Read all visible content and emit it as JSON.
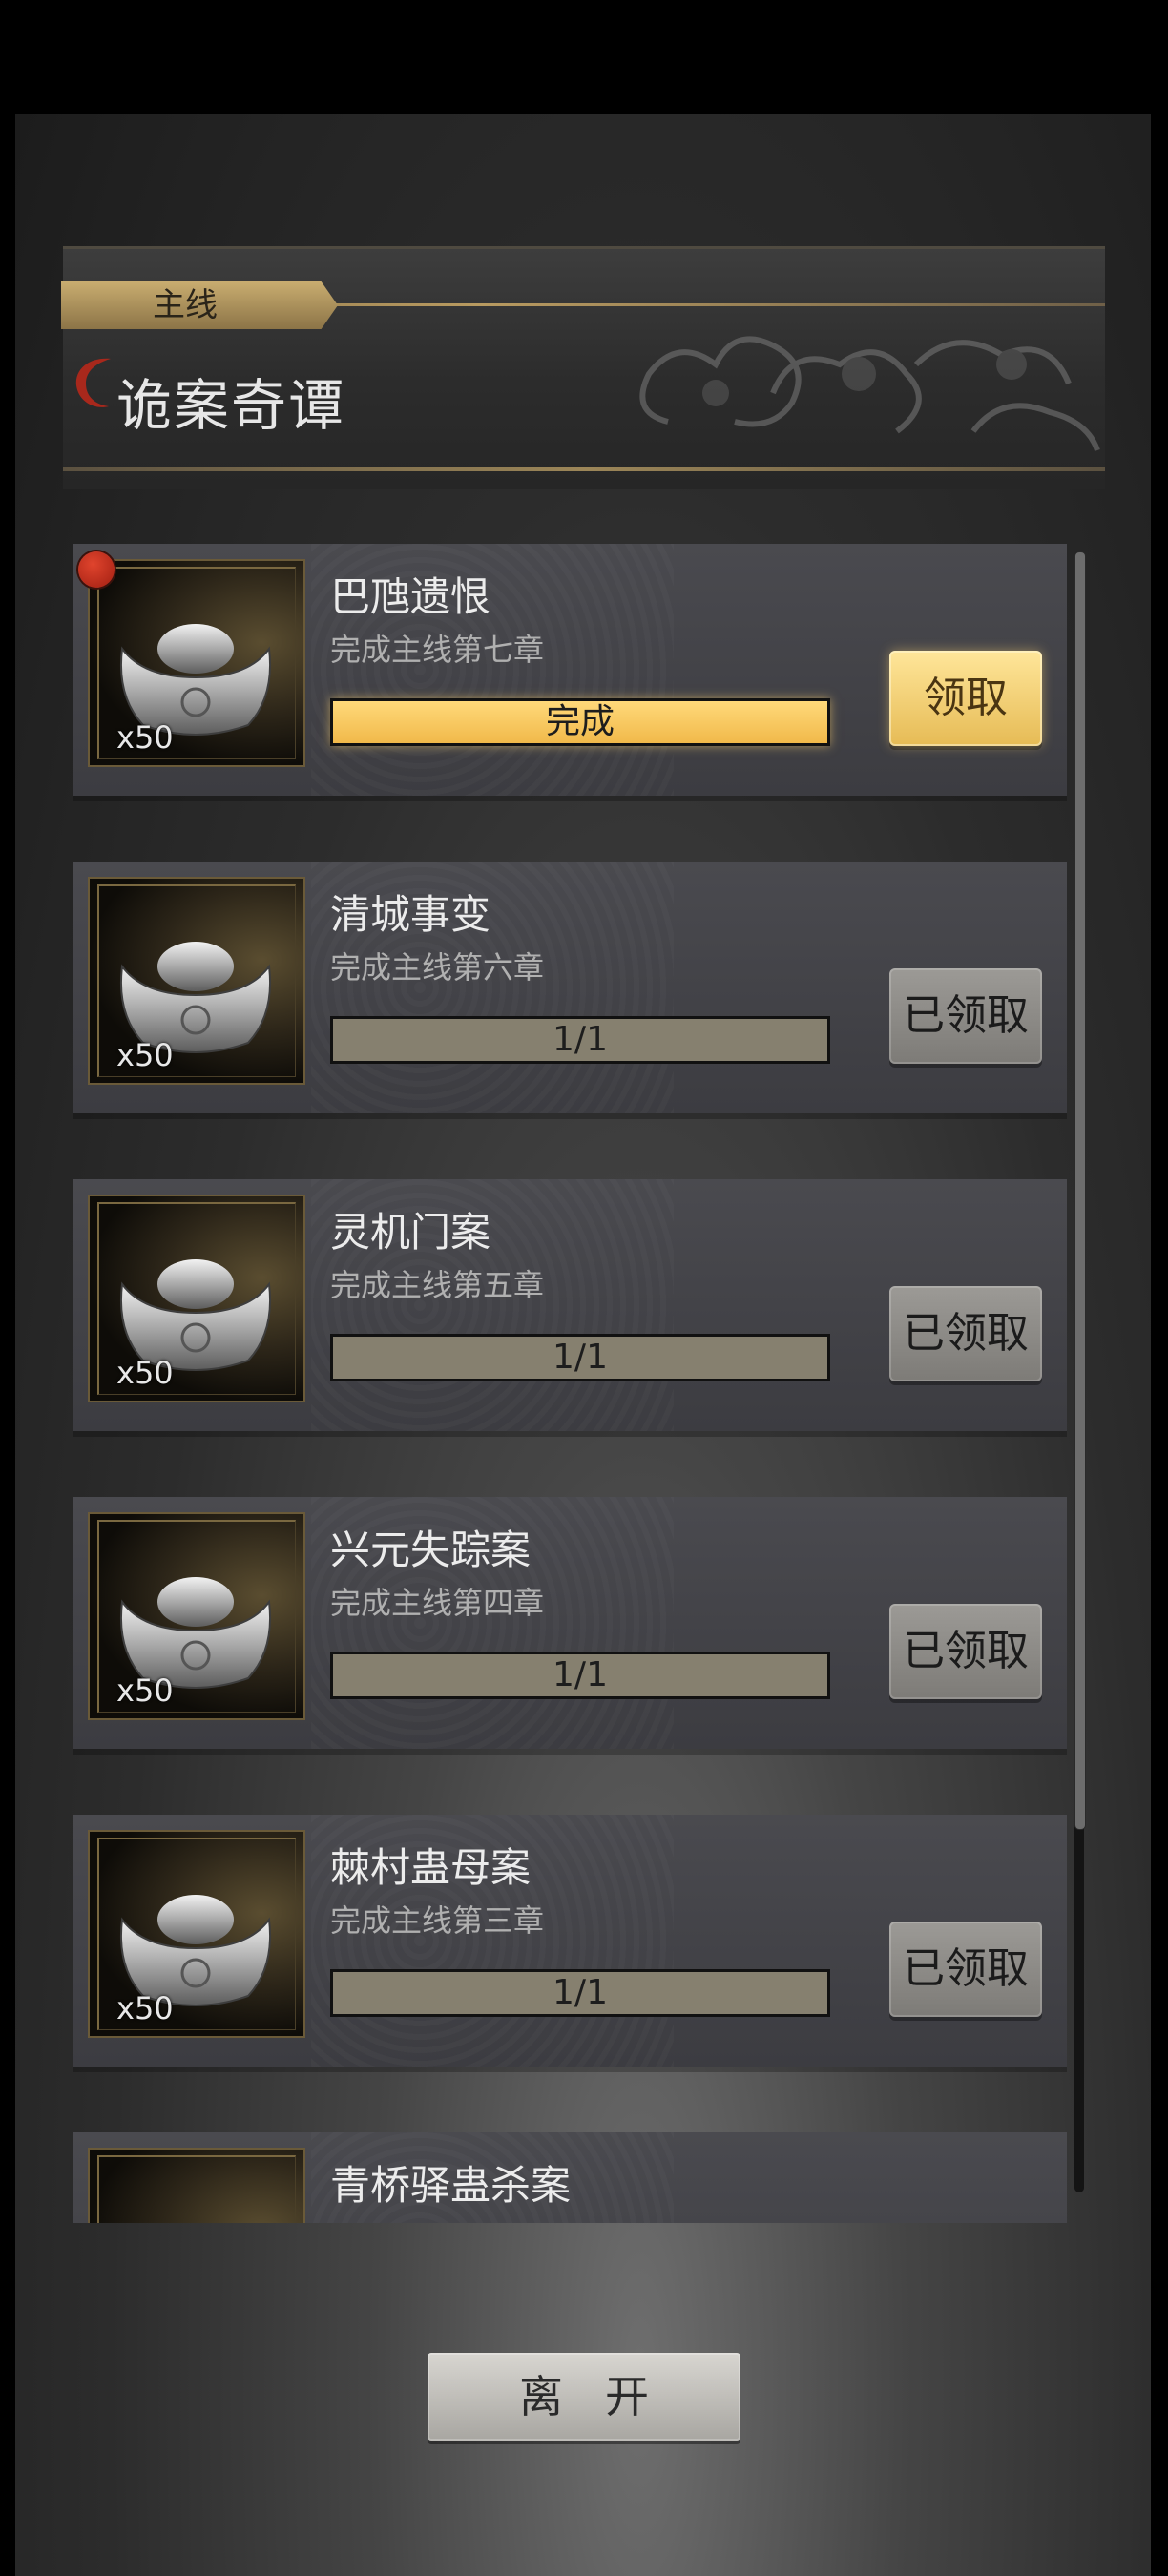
{
  "header": {
    "tab_label": "主线",
    "title": "诡案奇谭"
  },
  "tasks": [
    {
      "title": "巴虺遗恨",
      "desc": "完成主线第七章",
      "qty": "x50",
      "progress": "完成",
      "button": "领取",
      "state": "claimable",
      "badge": true
    },
    {
      "title": "清城事变",
      "desc": "完成主线第六章",
      "qty": "x50",
      "progress": "1/1",
      "button": "已领取",
      "state": "claimed",
      "badge": false
    },
    {
      "title": "灵机门案",
      "desc": "完成主线第五章",
      "qty": "x50",
      "progress": "1/1",
      "button": "已领取",
      "state": "claimed",
      "badge": false
    },
    {
      "title": "兴元失踪案",
      "desc": "完成主线第四章",
      "qty": "x50",
      "progress": "1/1",
      "button": "已领取",
      "state": "claimed",
      "badge": false
    },
    {
      "title": "棘村蛊母案",
      "desc": "完成主线第三章",
      "qty": "x50",
      "progress": "1/1",
      "button": "已领取",
      "state": "claimed",
      "badge": false
    },
    {
      "title": "青桥驿蛊杀案",
      "desc": "",
      "qty": "",
      "progress": "",
      "button": "",
      "state": "partial",
      "badge": false
    }
  ],
  "footer": {
    "leave_label": "离开"
  },
  "colors": {
    "gold": "#f1b94a",
    "badge_red": "#c0301d"
  },
  "icons": [
    "silver-ingot-icon",
    "red-notification-dot",
    "title-emblem-icon"
  ]
}
